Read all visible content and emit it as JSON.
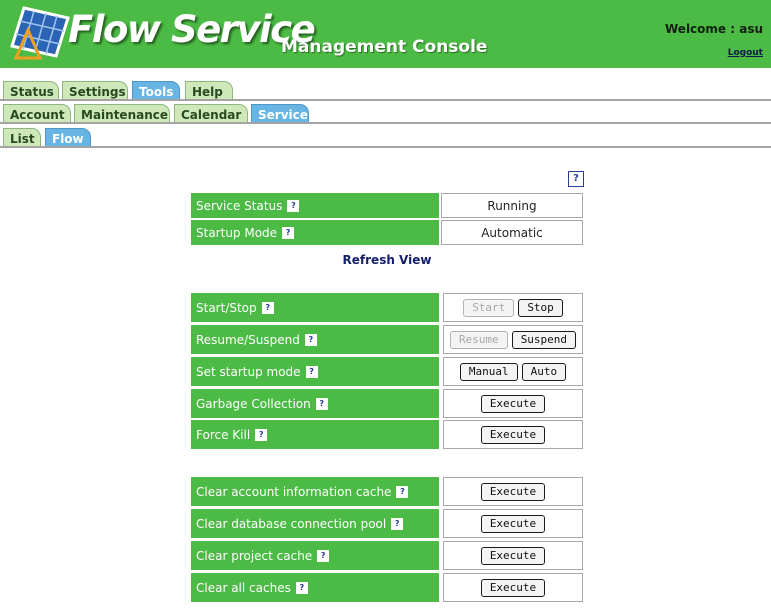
{
  "header": {
    "brand": "Flow Service",
    "subtitle": "Management Console",
    "welcome": "Welcome : asu",
    "logout": "Logout"
  },
  "tabs": {
    "row1": [
      "Status",
      "Settings",
      "Tools",
      "Help"
    ],
    "row2": [
      "Account",
      "Maintenance",
      "Calendar",
      "Service"
    ],
    "row3": [
      "List",
      "Flow"
    ]
  },
  "help_icon": "?",
  "status": {
    "service_status_label": "Service Status",
    "service_status_value": "Running",
    "startup_mode_label": "Startup Mode",
    "startup_mode_value": "Automatic"
  },
  "refresh_label": "Refresh View",
  "controls": {
    "start_stop_label": "Start/Stop",
    "start": "Start",
    "stop": "Stop",
    "resume_suspend_label": "Resume/Suspend",
    "resume": "Resume",
    "suspend": "Suspend",
    "startup_mode_label": "Set startup mode",
    "manual": "Manual",
    "auto": "Auto",
    "gc_label": "Garbage Collection",
    "force_kill_label": "Force Kill"
  },
  "caches": {
    "account_label": "Clear account information cache",
    "db_pool_label": "Clear database connection pool",
    "project_label": "Clear project cache",
    "all_label": "Clear all caches"
  },
  "execute": "Execute",
  "colors": {
    "green": "#4cbb45",
    "tab_inactive": "#cfe8b9",
    "tab_active": "#68b4e2"
  }
}
